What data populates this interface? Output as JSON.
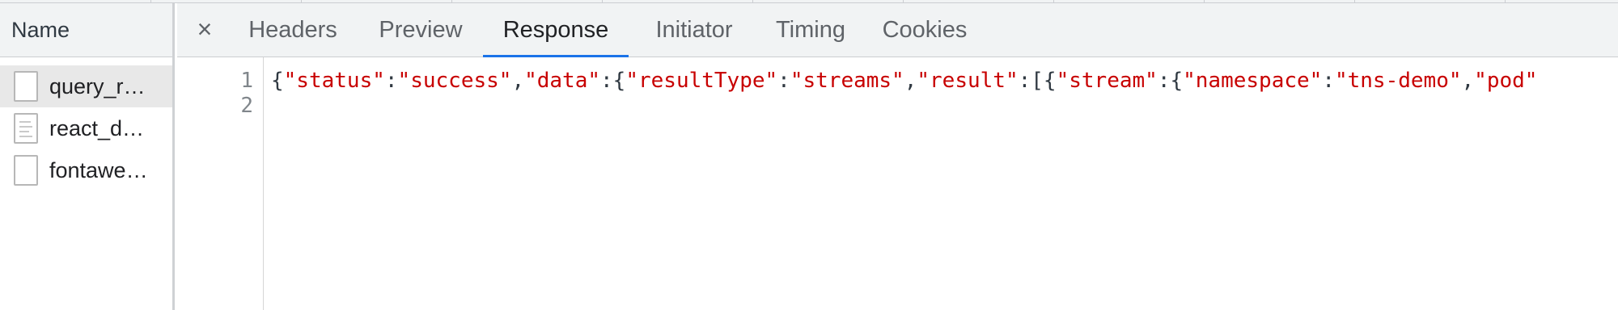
{
  "request_list": {
    "column_header": "Name",
    "items": [
      {
        "label": "query_r…",
        "selected": true,
        "icon": "blank-file-icon"
      },
      {
        "label": "react_d…",
        "selected": false,
        "icon": "document-file-icon"
      },
      {
        "label": "fontawe…",
        "selected": false,
        "icon": "blank-file-icon"
      }
    ]
  },
  "detail": {
    "close_glyph": "×",
    "tabs": [
      {
        "label": "Headers",
        "active": false
      },
      {
        "label": "Preview",
        "active": false
      },
      {
        "label": "Response",
        "active": true
      },
      {
        "label": "Initiator",
        "active": false
      },
      {
        "label": "Timing",
        "active": false
      },
      {
        "label": "Cookies",
        "active": false
      }
    ],
    "line_numbers": [
      "1",
      "2"
    ],
    "response_tokens": [
      {
        "t": "{",
        "k": "p"
      },
      {
        "t": "\"status\"",
        "k": "s"
      },
      {
        "t": ":",
        "k": "p"
      },
      {
        "t": "\"success\"",
        "k": "s"
      },
      {
        "t": ",",
        "k": "p"
      },
      {
        "t": "\"data\"",
        "k": "s"
      },
      {
        "t": ":{",
        "k": "p"
      },
      {
        "t": "\"resultType\"",
        "k": "s"
      },
      {
        "t": ":",
        "k": "p"
      },
      {
        "t": "\"streams\"",
        "k": "s"
      },
      {
        "t": ",",
        "k": "p"
      },
      {
        "t": "\"result\"",
        "k": "s"
      },
      {
        "t": ":[{",
        "k": "p"
      },
      {
        "t": "\"stream\"",
        "k": "s"
      },
      {
        "t": ":{",
        "k": "p"
      },
      {
        "t": "\"namespace\"",
        "k": "s"
      },
      {
        "t": ":",
        "k": "p"
      },
      {
        "t": "\"tns-demo\"",
        "k": "s"
      },
      {
        "t": ",",
        "k": "p"
      },
      {
        "t": "\"pod\"",
        "k": "s"
      }
    ]
  },
  "colors": {
    "accent": "#1a73e8",
    "string": "#c80000",
    "punctuation": "#303942",
    "toolbar_bg": "#f1f3f4",
    "selected_row": "#e8e8e8"
  }
}
